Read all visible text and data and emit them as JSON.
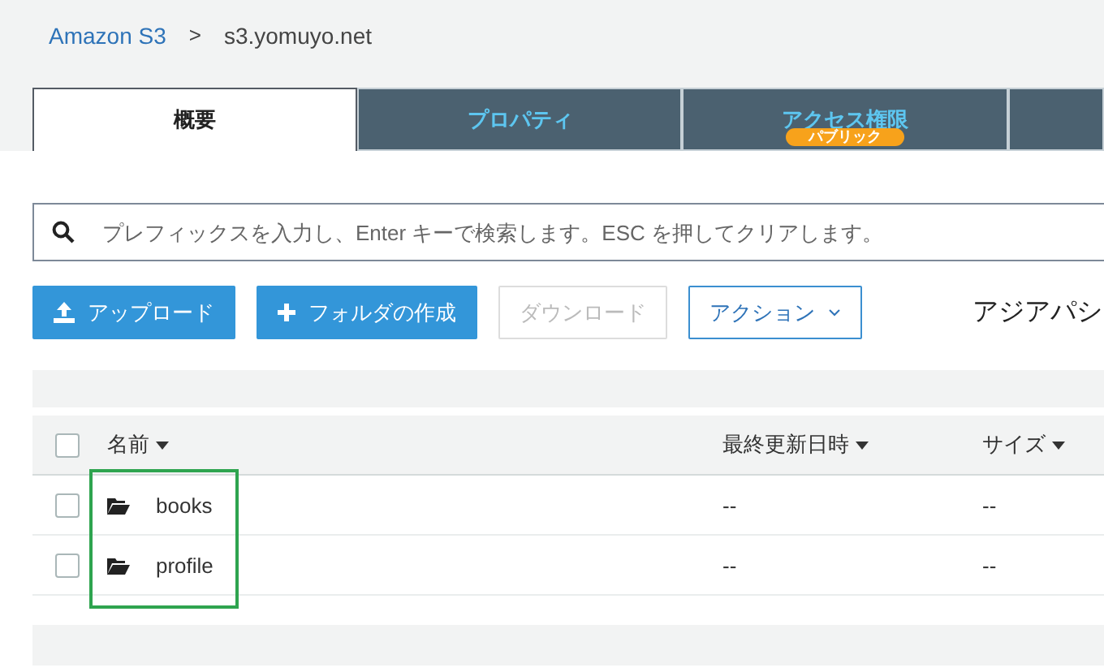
{
  "breadcrumb": {
    "link": "Amazon S3",
    "separator": ">",
    "current": "s3.yomuyo.net"
  },
  "tabs": [
    {
      "label": "概要",
      "selected": true
    },
    {
      "label": "プロパティ",
      "selected": false
    },
    {
      "label": "アクセス権限",
      "selected": false,
      "badge": "パブリック"
    }
  ],
  "search": {
    "placeholder": "プレフィックスを入力し、Enter キーで検索します。ESC を押してクリアします。"
  },
  "actions": [
    {
      "label": "アップロード",
      "kind": "upload",
      "disabled": false
    },
    {
      "label": "フォルダの作成",
      "kind": "create",
      "disabled": false
    },
    {
      "label": "ダウンロード",
      "kind": "plain",
      "disabled": true
    },
    {
      "label": "アクション",
      "kind": "menu",
      "disabled": false
    }
  ],
  "region": "アジアパシ",
  "table": {
    "columns": [
      "名前",
      "最終更新日時",
      "サイズ"
    ],
    "header_checked": false,
    "rows": [
      {
        "name": "books",
        "modified": "--",
        "size": "--",
        "checked": false
      },
      {
        "name": "profile",
        "modified": "--",
        "size": "--",
        "checked": false
      }
    ]
  }
}
